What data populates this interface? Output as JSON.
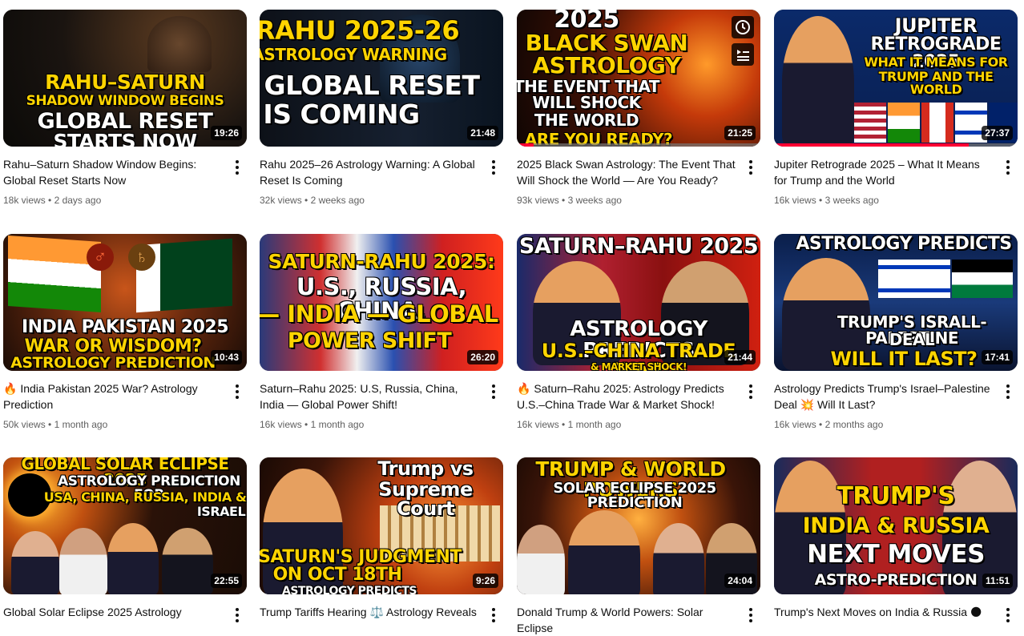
{
  "videos": [
    {
      "thumb_lines": [
        "RAHU–SATURN",
        "SHADOW WINDOW BEGINS",
        "GLOBAL RESET",
        "STARTS NOW"
      ],
      "duration": "19:26",
      "title": "Rahu–Saturn Shadow Window Begins: Global Reset Starts Now",
      "views": "18k views",
      "age": "2 days ago",
      "progress": 0
    },
    {
      "thumb_lines": [
        "RAHU 2025-26",
        "ASTROLOGY WARNING",
        "A GLOBAL RESET",
        "IS COMING"
      ],
      "duration": "21:48",
      "title": "Rahu 2025–26 Astrology Warning: A Global Reset Is Coming",
      "views": "32k views",
      "age": "2 weeks ago",
      "progress": 0
    },
    {
      "thumb_lines": [
        "2025",
        "BLACK SWAN",
        "ASTROLOGY",
        "THE EVENT THAT",
        "WILL SHOCK",
        "THE WORLD",
        "ARE YOU READY?"
      ],
      "duration": "21:25",
      "title": "2025 Black Swan Astrology: The Event That Will Shock the World — Are You Ready?",
      "views": "93k views",
      "age": "3 weeks ago",
      "progress": 0.07
    },
    {
      "thumb_lines": [
        "JUPITER",
        "RETROGRADE 2025",
        "WHAT IT MEANS FOR",
        "TRUMP AND THE WORLD"
      ],
      "duration": "27:37",
      "title": "Jupiter Retrograde 2025 – What It Means for Trump and the World",
      "views": "16k views",
      "age": "3 weeks ago",
      "progress": 0.8
    },
    {
      "thumb_lines": [
        "INDIA PAKISTAN 2025",
        "WAR OR WISDOM?",
        "ASTROLOGY PREDICTION"
      ],
      "duration": "10:43",
      "title": "India Pakistan 2025 War? Astrology Prediction",
      "title_emoji": "🔥",
      "views": "50k views",
      "age": "1 month ago",
      "progress": 0
    },
    {
      "thumb_lines": [
        "SATURN-RAHU 2025:",
        "U.S., RUSSIA, CHINA,",
        "— INDIA — GLOBAL",
        "POWER SHIFT"
      ],
      "duration": "26:20",
      "title": "Saturn–Rahu 2025: U.S, Russia, China, India — Global Power Shift!",
      "views": "16k views",
      "age": "1 month ago",
      "progress": 0
    },
    {
      "thumb_lines": [
        "SATURN–RAHU 2025",
        "ASTROLOGY PREDICTS",
        "U.S.–CHINA TRADE WAR",
        "& MARKET SHOCK!"
      ],
      "duration": "21:44",
      "title": "Saturn–Rahu 2025: Astrology Predicts U.S.–China Trade War & Market Shock!",
      "title_emoji": "🔥",
      "views": "16k views",
      "age": "1 month ago",
      "progress": 0
    },
    {
      "thumb_lines": [
        "ASTROLOGY PREDICTS",
        "TRUMP'S ISRALL-PALESTINE",
        "DEAL",
        "WILL IT LAST?"
      ],
      "duration": "17:41",
      "title": "Astrology Predicts Trump's Israel–Palestine Deal 💥 Will It Last?",
      "views": "16k views",
      "age": "2 months ago",
      "progress": 0
    },
    {
      "thumb_lines": [
        "GLOBAL SOLAR ECLIPSE 2025",
        "ASTROLOGY PREDICTION FOR",
        "USA, CHINA, RUSSIA, INDIA &",
        "ISRAEL"
      ],
      "duration": "22:55",
      "title": "Global Solar Eclipse 2025 Astrology",
      "views": "",
      "age": "",
      "progress": 0
    },
    {
      "thumb_lines": [
        "Trump vs",
        "Supreme Court",
        "SATURN'S JUDGMENT",
        "ON OCT 18TH",
        "ASTROLOGY PREDICTS"
      ],
      "duration": "9:26",
      "title": "Trump Tariffs Hearing ⚖️ Astrology Reveals",
      "views": "",
      "age": "",
      "progress": 0
    },
    {
      "thumb_lines": [
        "TRUMP & WORLD POWERS",
        "SOLAR ECLIPSE 2025 PREDICTION"
      ],
      "duration": "24:04",
      "title": "Donald Trump & World Powers: Solar Eclipse",
      "views": "",
      "age": "",
      "progress": 0
    },
    {
      "thumb_lines": [
        "TRUMP'S",
        "INDIA & RUSSIA",
        "NEXT MOVES",
        "ASTRO-PREDICTION"
      ],
      "duration": "11:51",
      "title": "Trump's Next Moves on India & Russia 🌑",
      "views": "",
      "age": "",
      "progress": 0
    }
  ],
  "icons": {
    "watch_later": "clock-icon",
    "add_to_queue": "queue-icon",
    "more": "more-vert-icon"
  },
  "colors": {
    "progress": "#ff0033",
    "meta_text": "#606060",
    "thumb_yellow": "#ffd400"
  }
}
